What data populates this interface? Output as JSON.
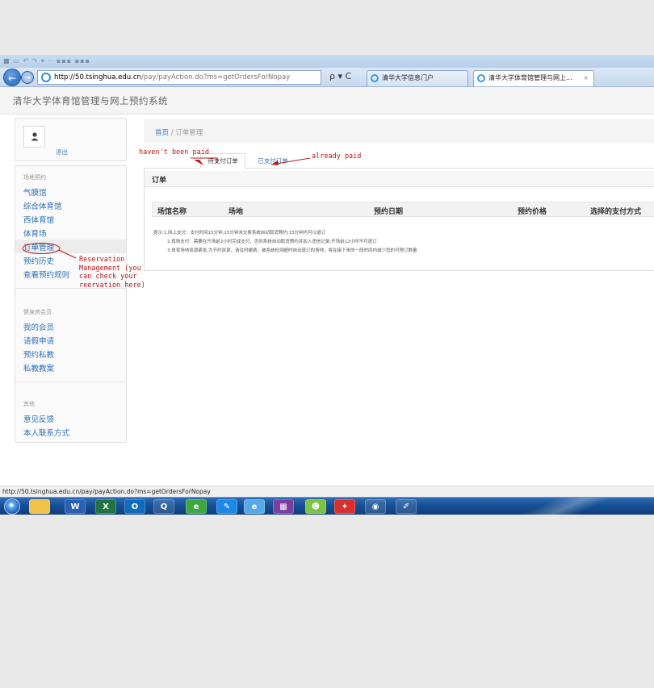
{
  "browser": {
    "url_host": "http://50.tsinghua.edu.cn",
    "url_path": "/pay/payAction.do?ms=getOrdersForNopay",
    "search_glyph": "ρ ▾ C",
    "tabs": [
      {
        "label": "清华大学信息门户"
      },
      {
        "label": "清华大学体育馆管理与网上...",
        "close": "×"
      }
    ],
    "status_url": "http://50.tsinghua.edu.cn/pay/payAction.do?ms=getOrdersForNopay"
  },
  "site": {
    "title": "清华大学体育馆管理与网上预约系统"
  },
  "user": {
    "logout_label": "退出"
  },
  "sidebar": {
    "groups": [
      {
        "heading": "场地预约",
        "items": [
          "气膜馆",
          "综合体育馆",
          "西体育馆",
          "体育场",
          "订单管理",
          "预约历史",
          "查看预约规则"
        ]
      },
      {
        "heading": "健身房会员",
        "items": [
          "我的会员",
          "请假申请",
          "预约私教",
          "私教教案"
        ]
      },
      {
        "heading": "其他",
        "items": [
          "意见反馈",
          "本人联系方式"
        ]
      }
    ],
    "active_item": "订单管理"
  },
  "breadcrumb": {
    "home": "首页",
    "separator": "/",
    "current": "订单管理"
  },
  "order_tabs": {
    "unpaid": "待支付订单",
    "paid": "已支付订单"
  },
  "panel": {
    "title": "订单",
    "columns": [
      "场馆名称",
      "场地",
      "预约日期",
      "预约价格",
      "选择的支付方式"
    ],
    "notes": [
      "提示:1.网上支付：支付时间15分钟,15分钟未交费系统自动取消预约;15分钟内可以退订",
      "2.现场支付：需要在开场前2小时完成支付，否则系统自动取消预约并加入违信记录;开场前12小时不可退订",
      "3.体育场地资源紧张,为节约资源，请及时缴费，被系统检测超时自动退订的场地，将在接下来的一段时间内减少您的可预订数量"
    ]
  },
  "annotations": {
    "unpaid": "haven't been paid",
    "paid": "already paid",
    "reservation": "Reservation\nManagement (you\ncan check your\nreervation here)"
  },
  "taskbar": {
    "icons": [
      "start-orb",
      "folder-icon",
      "word-icon",
      "excel-icon",
      "outlook-icon",
      "qq-icon",
      "ie-icon",
      "app-icon",
      "ie-icon",
      "app-icon",
      "wechat-icon",
      "pdf-icon",
      "app-icon",
      "paint-icon"
    ],
    "glyphs": [
      "",
      "",
      "W",
      "X",
      "O",
      "Q",
      "e",
      "✎",
      "e",
      "▦",
      "☻",
      "✦",
      "◉",
      "✐"
    ]
  },
  "colors": {
    "accent": "#2d6fb8",
    "annotation": "#b51a1a",
    "taskbar": "#174f94"
  }
}
